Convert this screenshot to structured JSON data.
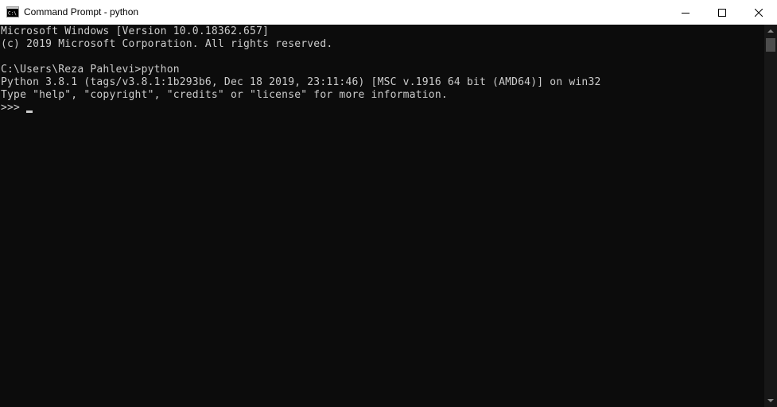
{
  "window": {
    "title": "Command Prompt - python",
    "app_icon": "command-prompt-icon",
    "controls": {
      "minimize_icon": "minimize-icon",
      "maximize_icon": "maximize-icon",
      "close_icon": "close-icon"
    }
  },
  "console": {
    "background": "#0c0c0c",
    "foreground": "#cccccc",
    "lines": [
      "Microsoft Windows [Version 10.0.18362.657]",
      "(c) 2019 Microsoft Corporation. All rights reserved.",
      "",
      "C:\\Users\\Reza Pahlevi>python",
      "Python 3.8.1 (tags/v3.8.1:1b293b6, Dec 18 2019, 23:11:46) [MSC v.1916 64 bit (AMD64)] on win32",
      "Type \"help\", \"copyright\", \"credits\" or \"license\" for more information.",
      ">>> "
    ]
  }
}
